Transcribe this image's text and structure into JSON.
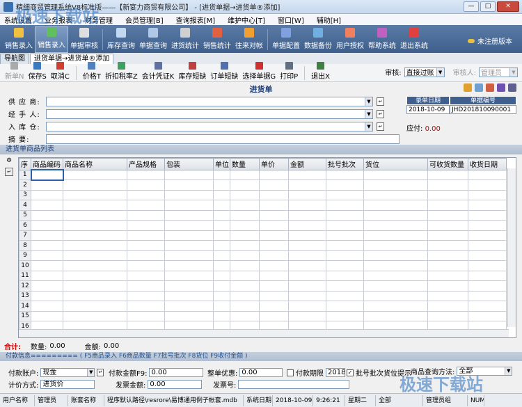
{
  "window": {
    "title": "精细商贸管理系统V8标准版——【新宴力商贸有限公司】 - [进货单据→进货单®添加]",
    "min": "—",
    "max": "□",
    "close": "✕"
  },
  "menu": [
    "系统设置",
    "业务报表",
    "财务管理",
    "会员管理[B]",
    "查询报表[M]",
    "维护中心[T]",
    "窗口[W]",
    "辅助[H]"
  ],
  "toolbar": [
    {
      "label": "销售录入",
      "icon": "cart-icon",
      "color": "#f0c040"
    },
    {
      "label": "销售录入",
      "icon": "barcode-icon",
      "color": "#60c060",
      "selected": true
    },
    {
      "label": "单据审核",
      "icon": "checklist-icon",
      "color": "#e0e0e0"
    },
    {
      "label": "库存查询",
      "icon": "magnifier-icon",
      "color": "#c0d8f0"
    },
    {
      "label": "单据查询",
      "icon": "doc-search-icon",
      "color": "#b0c8e8"
    },
    {
      "label": "进货统计",
      "icon": "truck-icon",
      "color": "#d0d0d0"
    },
    {
      "label": "销售统计",
      "icon": "bar-chart-icon",
      "color": "#e06040"
    },
    {
      "label": "往来对帐",
      "icon": "ledger-icon",
      "color": "#f0a030"
    },
    {
      "label": "单据配置",
      "icon": "config-icon",
      "color": "#80a0e0"
    },
    {
      "label": "数据备份",
      "icon": "database-icon",
      "color": "#70b0e0"
    },
    {
      "label": "用户授权",
      "icon": "users-icon",
      "color": "#f08060"
    },
    {
      "label": "帮助系统",
      "icon": "help-book-icon",
      "color": "#c060c0"
    },
    {
      "label": "退出系统",
      "icon": "exit-icon",
      "color": "#e04040"
    }
  ],
  "register": "未注册版本",
  "tabs": [
    "导航图",
    "进货单据→进货单®添加"
  ],
  "subtoolbar": [
    {
      "label": "新单N",
      "icon": "new-icon",
      "disabled": true,
      "color": "#aaaaaa"
    },
    {
      "label": "保存S",
      "icon": "save-icon",
      "color": "#3c7ac0"
    },
    {
      "label": "取消C",
      "icon": "cancel-icon",
      "color": "#d04030"
    },
    {
      "label": "价格T",
      "icon": "price-icon",
      "color": "#5080c0"
    },
    {
      "label": "折扣税率Z",
      "icon": "discount-icon",
      "color": "#40a060"
    },
    {
      "label": "会计凭证K",
      "icon": "voucher-icon",
      "color": "#6070a0"
    },
    {
      "label": "库存短缺",
      "icon": "stock-icon",
      "color": "#c04040"
    },
    {
      "label": "订单短缺",
      "icon": "order-icon",
      "color": "#5070b0"
    },
    {
      "label": "选择单据G",
      "icon": "select-doc-icon",
      "color": "#d03030"
    },
    {
      "label": "打印P",
      "icon": "printer-icon",
      "color": "#607080"
    },
    {
      "label": "退出X",
      "icon": "exit-door-icon",
      "color": "#408040"
    }
  ],
  "audit": {
    "label": "审核:",
    "value": "直接过账",
    "auditor_label": "审核人:",
    "auditor": "管理员"
  },
  "form": {
    "title": "进货单",
    "supplier": "供 应 商:",
    "handler": "经 手 人:",
    "warehouse": "入 库 仓:",
    "summary": "摘    要:"
  },
  "info": {
    "date_label": "录单日期",
    "no_label": "单据编号",
    "date": "2018-10-09",
    "no": "JHD201810090001",
    "payable_label": "应付:",
    "payable": "0.00"
  },
  "list": {
    "title": "进货单商品列表",
    "columns": [
      "序",
      "商品编码",
      "商品名称",
      "产品规格",
      "包装",
      "单位",
      "数量",
      "单价",
      "金额",
      "批号批次",
      "货位",
      "可收货数量",
      "收货日期"
    ],
    "rows": [
      "1",
      "2",
      "3",
      "4",
      "5",
      "6",
      "7",
      "8",
      "9",
      "10",
      "11",
      "12",
      "13",
      "14",
      "15",
      "16"
    ]
  },
  "totals": {
    "label": "合计:",
    "qty_label": "数量:",
    "qty": "0.00",
    "amount_label": "金额:",
    "amount": "0.00"
  },
  "payment": {
    "header": "付款信息=========",
    "keys": "( F5商品录入  F6商品数量  F7批号批次  F8货位  F9收付金额 )",
    "account_label": "付款账户:",
    "account": "现金",
    "pay_label": "付款金额F9:",
    "pay": "0.00",
    "discount_label": "整单优惠:",
    "discount": "0.00",
    "deadline_label": "付款期限",
    "deadline": "2018-",
    "batch_tip": "批号批次货位提示",
    "query_label": "商品查询方法:",
    "query": "全部",
    "method_label": "计价方式:",
    "method": "进货价",
    "invoice_label": "发票金额:",
    "invoice": "0.00",
    "invoice_no_label": "发票号:",
    "invoice_no": ""
  },
  "status": [
    "用户名称",
    "管理员",
    "账套名称",
    "程序默认路径\\resrore\\易博通用例子帐套.mdb",
    "系统日期",
    "2018-10-09",
    "9:26:21",
    "星期二",
    "全部",
    "管理员组",
    "NUM"
  ],
  "watermark": "极速下载站"
}
